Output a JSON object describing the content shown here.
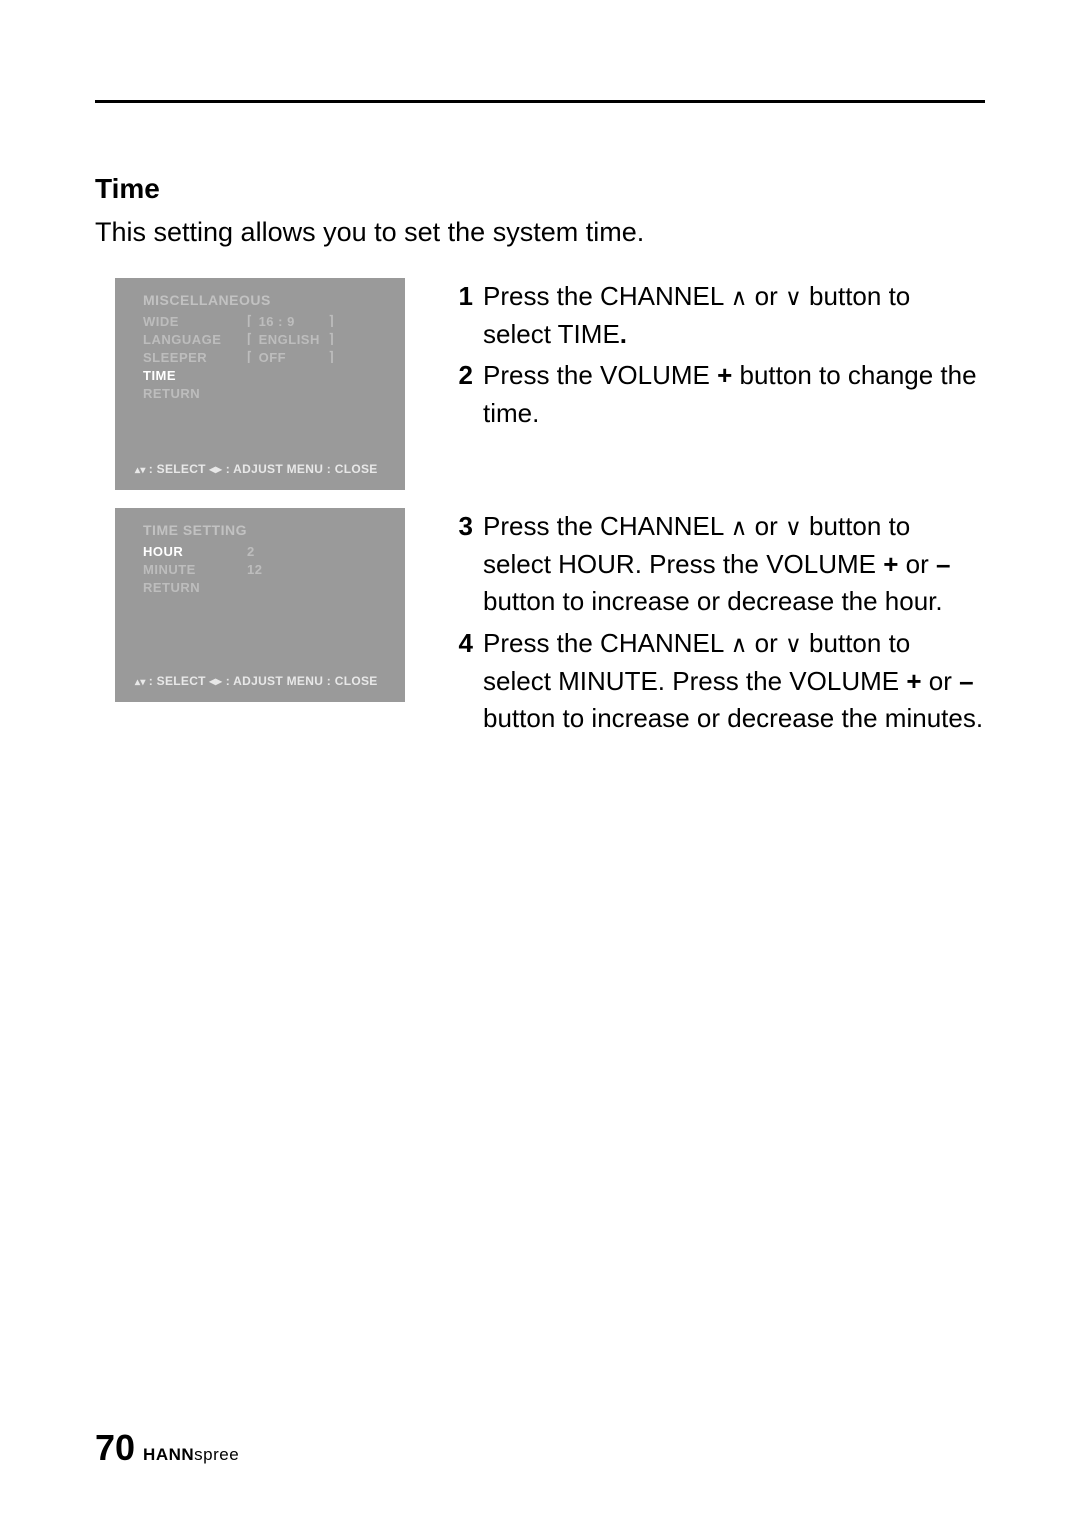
{
  "section": {
    "title": "Time",
    "description": "This setting allows you to set the system time."
  },
  "osd1": {
    "title": "MISCELLANEOUS",
    "rows": [
      {
        "label": "WIDE",
        "value": "16 : 9"
      },
      {
        "label": "LANGUAGE",
        "value": "ENGLISH"
      },
      {
        "label": "SLEEPER",
        "value": "OFF"
      }
    ],
    "highlight": "TIME",
    "return": "RETURN",
    "footer": ": SELECT   ◂▸ : ADJUST   MENU : CLOSE"
  },
  "osd2": {
    "title": "TIME SETTING",
    "highlight": "HOUR",
    "highlight_value": "2",
    "rows": [
      {
        "label": "MINUTE",
        "value": "12"
      }
    ],
    "return": "RETURN",
    "footer": ": SELECT   ◂▸ : ADJUST   MENU : CLOSE"
  },
  "steps1": {
    "1": {
      "pre": "Press the CHANNEL ",
      "mid": " or ",
      "post": " button to select TIME",
      "end": "."
    },
    "2": {
      "pre": "Press the VOLUME ",
      "plus": "+",
      "post": " button to change the time."
    }
  },
  "steps2": {
    "3": {
      "a": "Press the CHANNEL ",
      "b": " or ",
      "c": " button to select HOUR. Press the VOLUME ",
      "plus": "+",
      "d": " or ",
      "minus": "–",
      "e": " button to increase or decrease the hour."
    },
    "4": {
      "a": "Press the CHANNEL ",
      "b": " or ",
      "c": " button to select MINUTE. Press the VOLUME ",
      "plus": "+",
      "d": " or ",
      "minus": "–",
      "e": " button to increase or decrease the minutes."
    }
  },
  "footer": {
    "page": "70",
    "brand_bold": "HANN",
    "brand_light": "spree"
  }
}
